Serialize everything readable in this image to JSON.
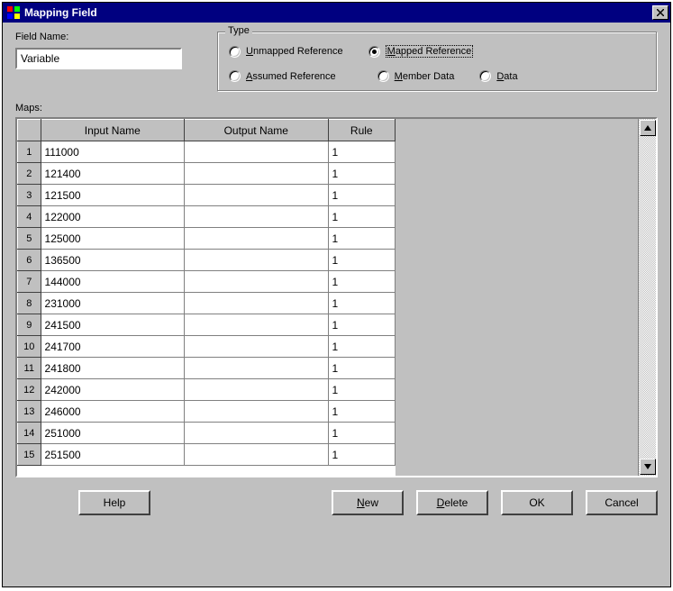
{
  "title": "Mapping Field",
  "fieldName": {
    "label": "Field Name:",
    "value": "Variable"
  },
  "typeGroup": {
    "legend": "Type",
    "options": {
      "unmapped": {
        "prefix": "U",
        "rest": "nmapped Reference",
        "checked": false
      },
      "mapped": {
        "prefix": "M",
        "rest": "apped Reference",
        "checked": true
      },
      "assumed": {
        "prefix": "A",
        "rest": "ssumed Reference",
        "checked": false
      },
      "member": {
        "prefix": "M",
        "rest": "ember Data",
        "checked": false
      },
      "data": {
        "prefix": "D",
        "rest": "ata",
        "checked": false
      }
    }
  },
  "mapsLabel": "Maps:",
  "gridHeaders": {
    "input": "Input Name",
    "output": "Output Name",
    "rule": "Rule"
  },
  "rows": [
    {
      "n": "1",
      "input": "111000",
      "output": "",
      "rule": "1"
    },
    {
      "n": "2",
      "input": "121400",
      "output": "",
      "rule": "1"
    },
    {
      "n": "3",
      "input": "121500",
      "output": "",
      "rule": "1"
    },
    {
      "n": "4",
      "input": "122000",
      "output": "",
      "rule": "1"
    },
    {
      "n": "5",
      "input": "125000",
      "output": "",
      "rule": "1"
    },
    {
      "n": "6",
      "input": "136500",
      "output": "",
      "rule": "1"
    },
    {
      "n": "7",
      "input": "144000",
      "output": "",
      "rule": "1"
    },
    {
      "n": "8",
      "input": "231000",
      "output": "",
      "rule": "1"
    },
    {
      "n": "9",
      "input": "241500",
      "output": "",
      "rule": "1"
    },
    {
      "n": "10",
      "input": "241700",
      "output": "",
      "rule": "1"
    },
    {
      "n": "11",
      "input": "241800",
      "output": "",
      "rule": "1"
    },
    {
      "n": "12",
      "input": "242000",
      "output": "",
      "rule": "1"
    },
    {
      "n": "13",
      "input": "246000",
      "output": "",
      "rule": "1"
    },
    {
      "n": "14",
      "input": "251000",
      "output": "",
      "rule": "1"
    },
    {
      "n": "15",
      "input": "251500",
      "output": "",
      "rule": "1"
    }
  ],
  "buttons": {
    "help": "Help",
    "new": {
      "prefix": "N",
      "rest": "ew"
    },
    "delete": {
      "prefix": "D",
      "rest": "elete"
    },
    "ok": "OK",
    "cancel": "Cancel"
  }
}
